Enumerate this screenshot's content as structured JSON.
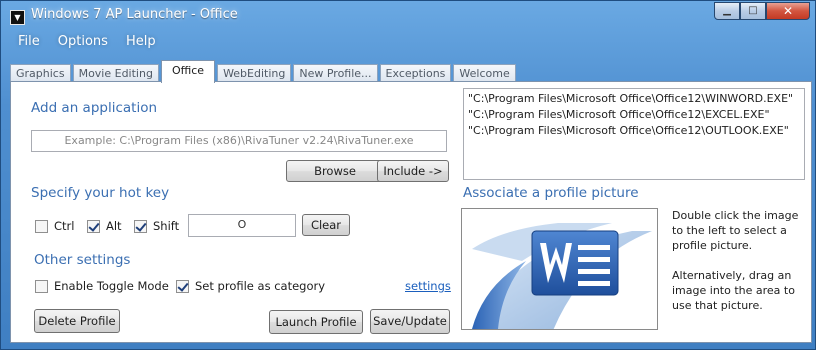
{
  "window": {
    "title": "Windows 7 AP Launcher - Office",
    "icon": "launcher-app-icon",
    "caption_buttons": {
      "minimize": "minimize-icon",
      "maximize": "maximize-icon",
      "close": "close-icon"
    }
  },
  "menu": [
    "File",
    "Options",
    "Help"
  ],
  "tabs": [
    {
      "label": "Graphics",
      "active": false
    },
    {
      "label": "Movie Editing",
      "active": false
    },
    {
      "label": "Office",
      "active": true
    },
    {
      "label": "WebEditing",
      "active": false
    },
    {
      "label": "New Profile...",
      "active": false
    },
    {
      "label": "Exceptions",
      "active": false
    },
    {
      "label": "Welcome",
      "active": false
    }
  ],
  "add_app": {
    "heading": "Add an application",
    "input_placeholder": "Example: C:\\Program Files (x86)\\RivaTuner v2.24\\RivaTuner.exe",
    "browse_label": "Browse",
    "include_label": "Include ->"
  },
  "hotkey": {
    "heading": "Specify your hot key",
    "ctrl": {
      "label": "Ctrl",
      "checked": false
    },
    "alt": {
      "label": "Alt",
      "checked": true
    },
    "shift": {
      "label": "Shift",
      "checked": true
    },
    "key_value": "O",
    "clear_label": "Clear"
  },
  "other": {
    "heading": "Other settings",
    "toggle_mode": {
      "label": "Enable Toggle Mode",
      "checked": false
    },
    "profile_category": {
      "label": "Set profile as category",
      "checked": true
    },
    "settings_link": "settings"
  },
  "buttons": {
    "delete": "Delete Profile",
    "launch": "Launch Profile",
    "save": "Save/Update"
  },
  "app_paths": [
    "\"C:\\Program Files\\Microsoft Office\\Office12\\WINWORD.EXE\"",
    "\"C:\\Program Files\\Microsoft Office\\Office12\\EXCEL.EXE\"",
    "\"C:\\Program Files\\Microsoft Office\\Office12\\OUTLOOK.EXE\""
  ],
  "picture": {
    "heading": "Associate a profile picture",
    "image_icon": "microsoft-word-icon",
    "help_1": "Double click the image to the left to select a profile picture.",
    "help_2": "Alternatively, drag an image into the area to use that picture."
  },
  "colors": {
    "accent_heading": "#3b6fb2",
    "titlebar": "#4f8fd0",
    "link": "#1b5fbd"
  }
}
